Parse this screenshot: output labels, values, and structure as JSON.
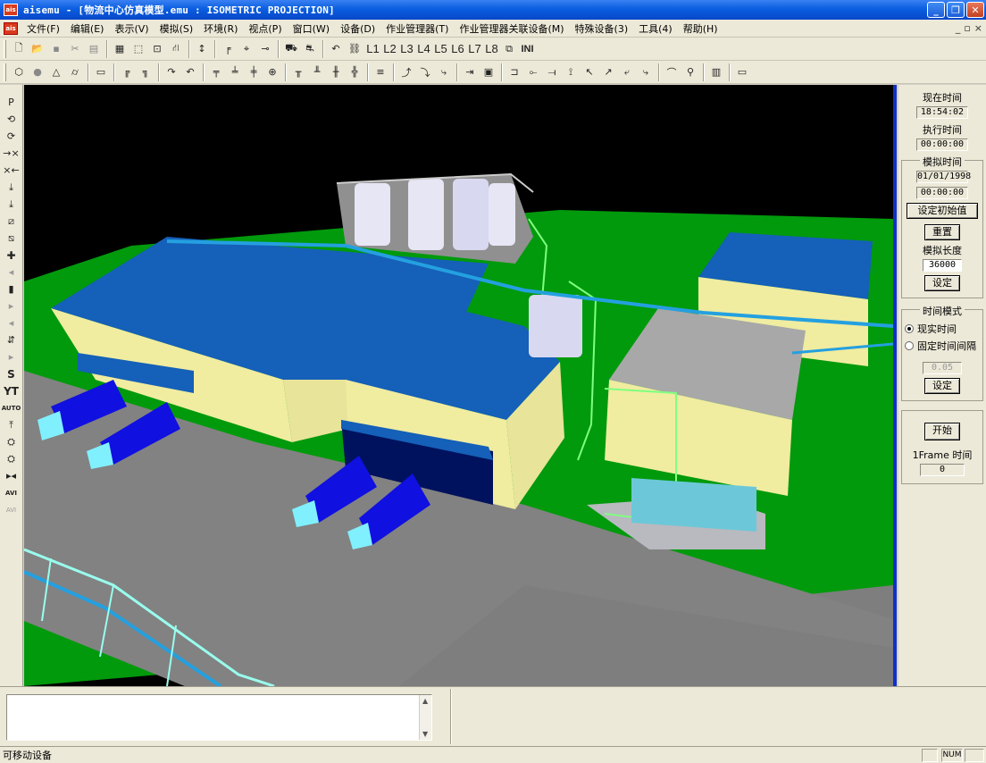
{
  "window": {
    "title": "aisemu - [物流中心仿真模型.emu : ISOMETRIC PROJECTION]",
    "icon_label": "ais",
    "buttons": [
      "minimize-icon",
      "restore-icon",
      "close-icon"
    ]
  },
  "menu": {
    "items": [
      "文件(F)",
      "编辑(E)",
      "表示(V)",
      "模拟(S)",
      "环境(R)",
      "视点(P)",
      "窗口(W)",
      "设备(D)",
      "作业管理器(T)",
      "作业管理器关联设备(M)",
      "特殊设备(3)",
      "工具(4)",
      "帮助(H)"
    ],
    "mdi_buttons": [
      "_",
      "▫",
      "×"
    ]
  },
  "toolbar1": {
    "layer_buttons": [
      "L1",
      "L2",
      "L3",
      "L4",
      "L5",
      "L6",
      "L7",
      "L8"
    ],
    "ini_label": "INI"
  },
  "left_toolbar": {
    "labels": [
      "P",
      "⟲",
      "⟳",
      "→×",
      "×←",
      "⤓",
      "⤓",
      "⧄",
      "⧅",
      "✚",
      "◂",
      "▮",
      "▸",
      "◂",
      "⇵",
      "▸",
      "S",
      "YT",
      "AUTO",
      "⤒",
      "⛭",
      "⛭",
      "▸◂",
      "AVI",
      "AVI"
    ]
  },
  "right_panel": {
    "current_time_label": "现在时间",
    "current_time": "18:54:02",
    "exec_time_label": "执行时间",
    "exec_time": "00:00:00",
    "sim_group_title": "模拟时间",
    "sim_date": "01/01/1998",
    "sim_time": "00:00:00",
    "set_initial_button": "设定初始值",
    "reset_button": "重置",
    "sim_length_label": "模拟长度",
    "sim_length": "36000",
    "set_button": "设定",
    "time_mode_title": "时间模式",
    "mode_realtime": "现实时间",
    "mode_fixed": "固定时间间隔",
    "interval_value": "0.05",
    "set_button_2": "设定",
    "start_button": "开始",
    "frame_label": "1Frame 时间",
    "frame_value": "0"
  },
  "colors": {
    "roof_blue": "#1560b8",
    "wall_cream": "#f0eca0",
    "ground_green": "#009a0c",
    "road_gray": "#7e7e7e",
    "truck_blue": "#1010e0",
    "scaffold_green": "#80ff80"
  },
  "status": {
    "text": "可移动设备",
    "num_indicator": "NUM"
  }
}
